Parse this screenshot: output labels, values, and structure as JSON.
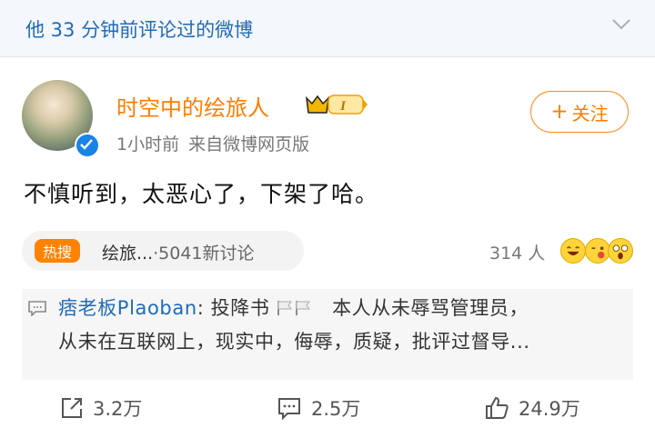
{
  "header": {
    "title": "他 33 分钟前评论过的微博",
    "chevron_icon": "chevron-down-icon"
  },
  "post": {
    "username": "时空中的绘旅人",
    "level_badge": "I",
    "time": "1小时前",
    "source": "来自微博网页版",
    "follow_label": "关注",
    "content": "不慎听到，太恶心了，下架了哈。",
    "topic": {
      "hot_label": "热搜",
      "name": "绘旅...",
      "count": "·5041新讨论"
    },
    "reaction_people": "314 人",
    "comment": {
      "user": "痞老板Plaoban",
      "line1_text": ": 投降书",
      "line1_tail": "本人从未辱骂管理员，",
      "line2": "从未在互联网上，现实中，侮辱，质疑，批评过督导..."
    },
    "actions": {
      "repost": "3.2万",
      "comments": "2.5万",
      "likes": "24.9万"
    }
  },
  "colors": {
    "accent": "#ff7c00",
    "link": "#1f6bb8",
    "verified": "#1a83e8"
  }
}
